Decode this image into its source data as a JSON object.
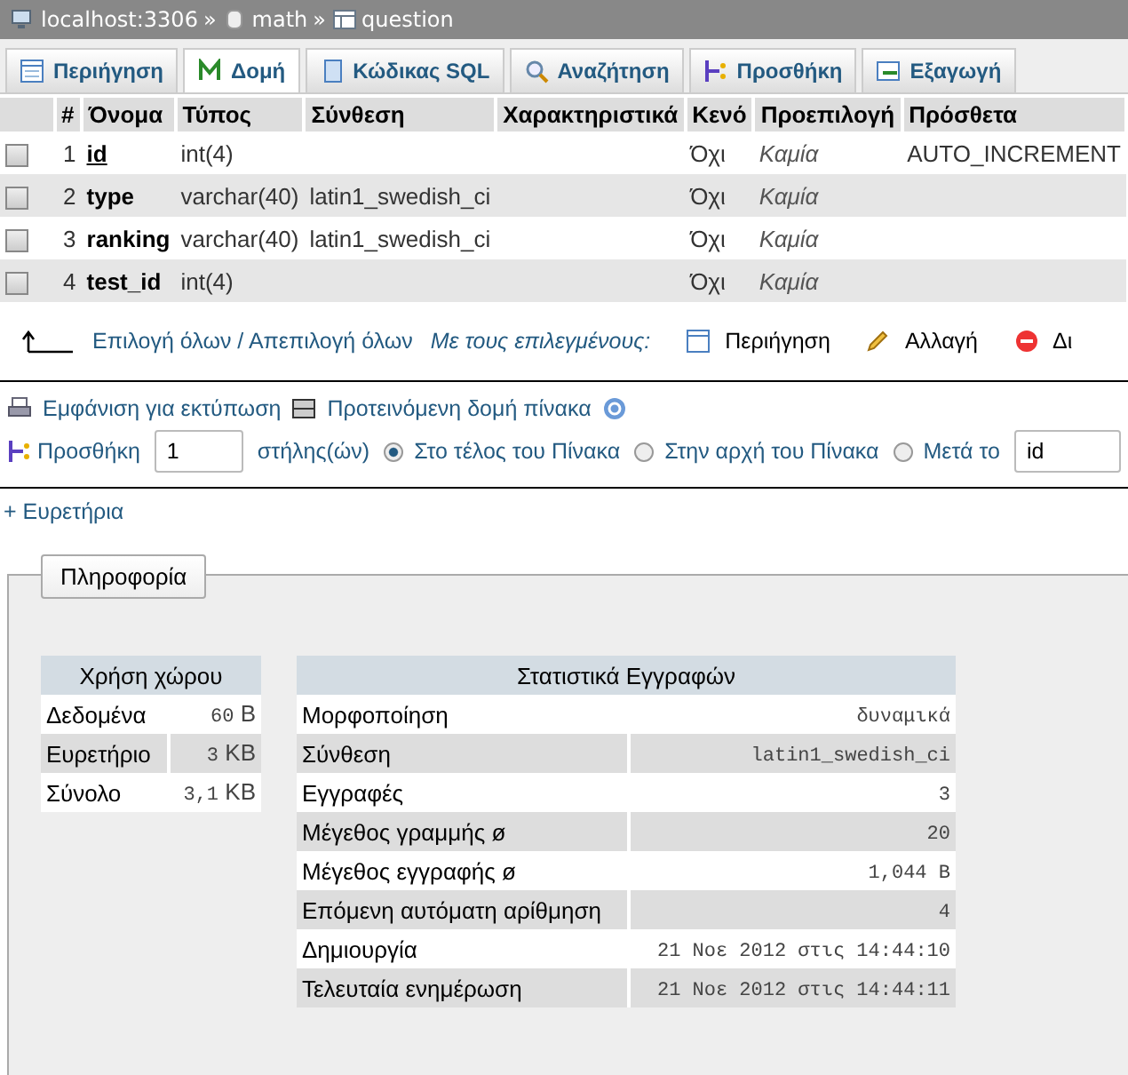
{
  "breadcrumb": [
    {
      "kind": "server",
      "label": "localhost:3306"
    },
    {
      "kind": "database",
      "label": "math"
    },
    {
      "kind": "table",
      "label": "question"
    }
  ],
  "separator": "»",
  "tabs": [
    {
      "kind": "browse",
      "label": "Περιήγηση",
      "selected": false
    },
    {
      "kind": "structure",
      "label": "Δομή",
      "selected": true
    },
    {
      "kind": "sql",
      "label": "Κώδικας SQL",
      "selected": false
    },
    {
      "kind": "search",
      "label": "Αναζήτηση",
      "selected": false
    },
    {
      "kind": "insert",
      "label": "Προσθήκη",
      "selected": false
    },
    {
      "kind": "export",
      "label": "Εξαγωγή",
      "selected": false
    }
  ],
  "table": {
    "columns": [
      "#",
      "Όνομα",
      "Τύπος",
      "Σύνθεση",
      "Χαρακτηριστικά",
      "Κενό",
      "Προεπιλογή",
      "Πρόσθετα"
    ],
    "rows": [
      {
        "checked": false,
        "num": "1",
        "name": "id",
        "primary": true,
        "type": "int(4)",
        "collation": "",
        "null": "Όχι",
        "default": "Καμία",
        "extra": "AUTO_INCREMENT"
      },
      {
        "checked": false,
        "num": "2",
        "name": "type",
        "primary": false,
        "type": "varchar(40)",
        "collation": "latin1_swedish_ci",
        "null": "Όχι",
        "default": "Καμία",
        "extra": ""
      },
      {
        "checked": false,
        "num": "3",
        "name": "ranking",
        "primary": false,
        "type": "varchar(40)",
        "collation": "latin1_swedish_ci",
        "null": "Όχι",
        "default": "Καμία",
        "extra": ""
      },
      {
        "checked": false,
        "num": "4",
        "name": "test_id",
        "primary": false,
        "type": "int(4)",
        "collation": "",
        "null": "Όχι",
        "default": "Καμία",
        "extra": ""
      }
    ]
  },
  "bulk": {
    "select_all": "Επιλογή όλων / Απεπιλογή όλων",
    "with_selected": "Με τους επιλεγμένους:",
    "actions": [
      {
        "kind": "browse",
        "label": "Περιήγηση"
      },
      {
        "kind": "edit",
        "label": "Αλλαγή"
      },
      {
        "kind": "drop",
        "label": "Δι"
      }
    ]
  },
  "print_view": "Εμφάνιση για εκτύπωση",
  "propose": "Προτεινόμενη δομή πίνακα",
  "add_columns": {
    "label": "Προσθήκη",
    "count": "1",
    "unit": "στήλης(ών)",
    "options": [
      {
        "label": "Στο τέλος του Πίνακα",
        "selected": true
      },
      {
        "label": "Στην αρχή του Πίνακα",
        "selected": false
      },
      {
        "label": "Μετά το",
        "selected": false
      }
    ],
    "after_field": "id"
  },
  "indexes_link": "+ Ευρετήρια",
  "info": {
    "legend": "Πληροφορία",
    "space": {
      "title": "Χρήση χώρου",
      "rows": [
        {
          "label": "Δεδομένα",
          "value": "60",
          "unit": "B"
        },
        {
          "label": "Ευρετήριο",
          "value": "3",
          "unit": "KB"
        },
        {
          "label": "Σύνολο",
          "value": "3,1",
          "unit": "KB"
        }
      ]
    },
    "stats": {
      "title": "Στατιστικά Εγγραφών",
      "rows": [
        {
          "label": "Μορφοποίηση",
          "value": "δυναμικά"
        },
        {
          "label": "Σύνθεση",
          "value": "latin1_swedish_ci"
        },
        {
          "label": "Εγγραφές",
          "value": "3"
        },
        {
          "label": "Μέγεθος γραμμής ø",
          "value": "20"
        },
        {
          "label": "Μέγεθος εγγραφής ø",
          "value": "1,044 B"
        },
        {
          "label": "Επόμενη αυτόματη αρίθμηση",
          "value": "4"
        },
        {
          "label": "Δημιουργία",
          "value": "21 Νοε 2012 στις 14:44:10"
        },
        {
          "label": "Τελευταία ενημέρωση",
          "value": "21 Νοε 2012 στις 14:44:11"
        }
      ]
    }
  }
}
